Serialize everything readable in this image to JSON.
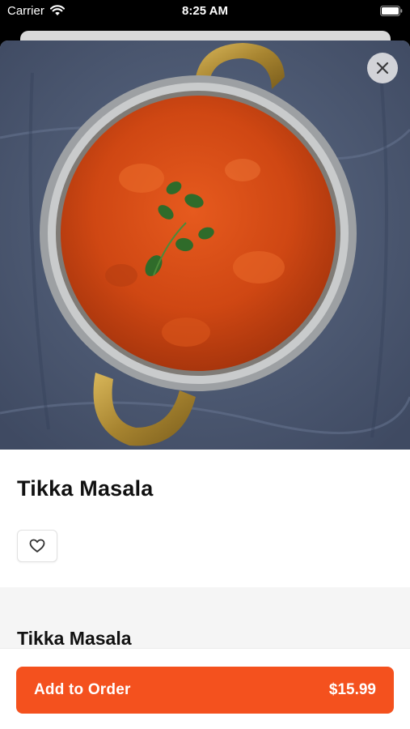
{
  "status_bar": {
    "carrier": "Carrier",
    "time": "8:25 AM"
  },
  "item": {
    "title": "Tikka Masala",
    "section_title": "Tikka Masala"
  },
  "order_button": {
    "label": "Add to Order",
    "price": "$15.99"
  },
  "icons": {
    "close": "close-icon",
    "favorite": "heart-outline-icon",
    "wifi": "wifi-icon",
    "battery": "battery-icon"
  },
  "colors": {
    "accent": "#f4511e",
    "background": "#ffffff",
    "section_bg": "#f5f5f5"
  }
}
